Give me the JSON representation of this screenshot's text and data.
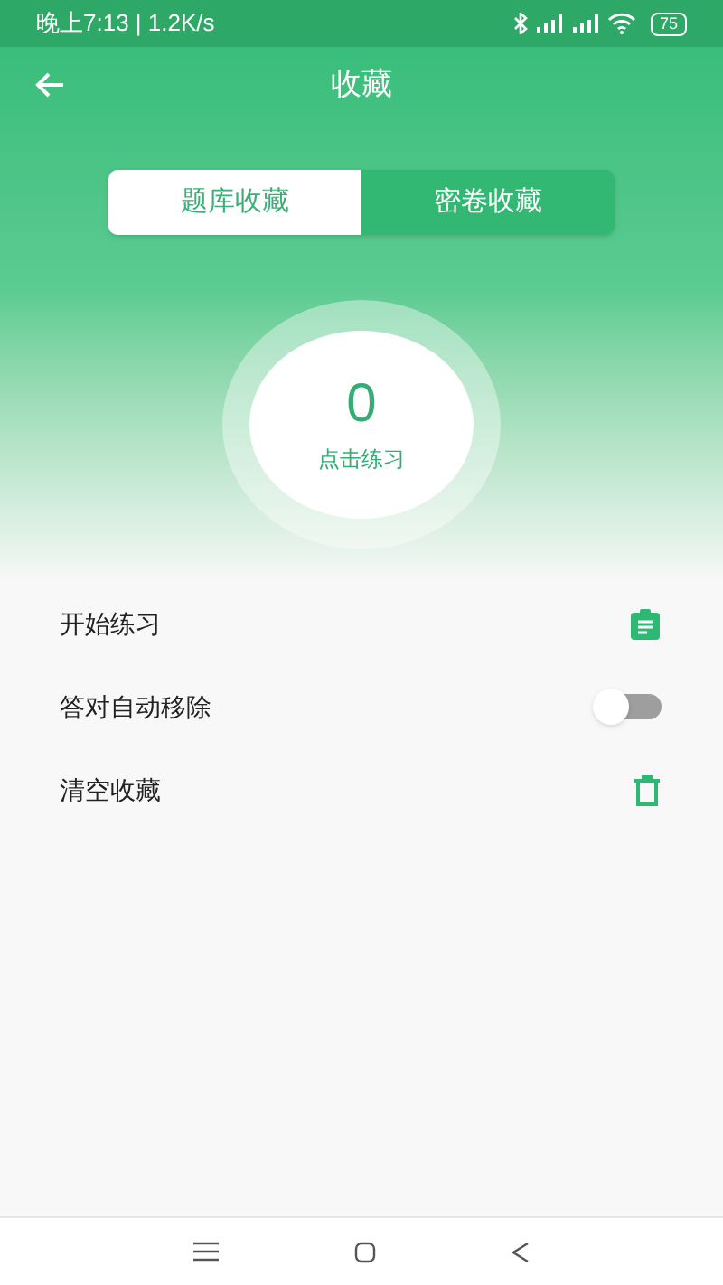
{
  "status_bar": {
    "time": "晚上7:13 | 1.2K/s",
    "battery": "75"
  },
  "header": {
    "title": "收藏"
  },
  "tabs": [
    {
      "label": "题库收藏",
      "selected": true
    },
    {
      "label": "密卷收藏",
      "selected": false
    }
  ],
  "counter": {
    "value": "0",
    "caption": "点击练习"
  },
  "options": [
    {
      "kind": "start",
      "label": "开始练习"
    },
    {
      "kind": "toggle",
      "label": "答对自动移除",
      "on": false
    },
    {
      "kind": "clear",
      "label": "清空收藏"
    }
  ]
}
